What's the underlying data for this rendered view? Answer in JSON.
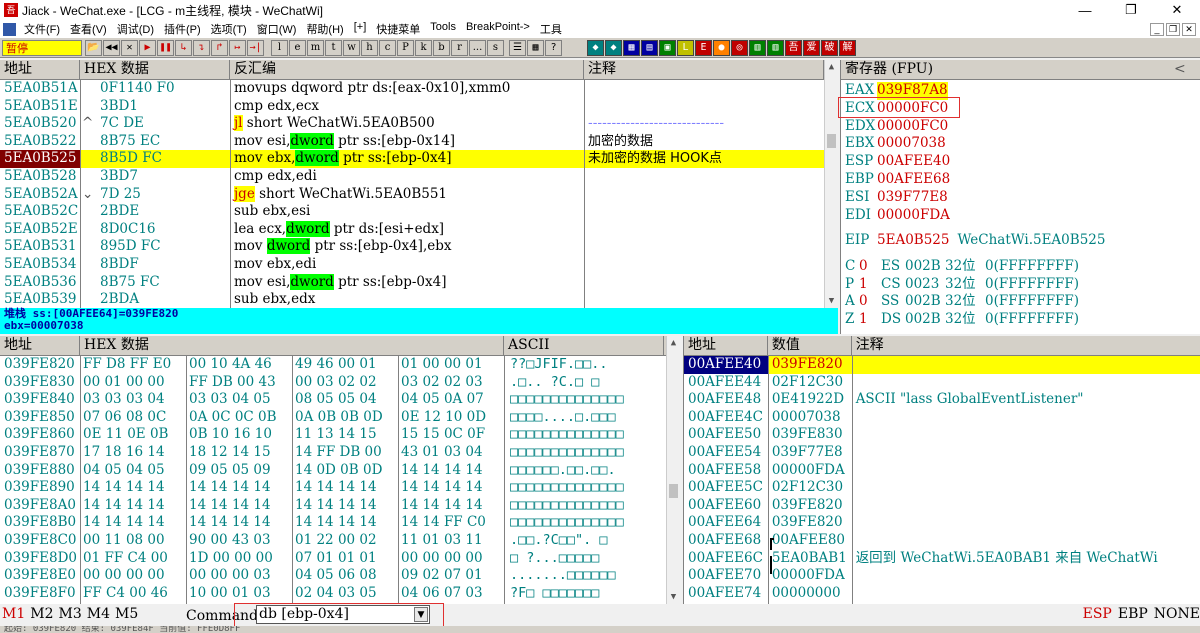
{
  "window": {
    "title": "Jiack  - WeChat.exe - [LCG - m主线程, 模块 - WeChatWi]",
    "min": "—",
    "max": "❐",
    "close": "✕"
  },
  "menu": [
    "文件(F)",
    "查看(V)",
    "调试(D)",
    "插件(P)",
    "选项(T)",
    "窗口(W)",
    "帮助(H)",
    "[+]",
    "快捷菜单",
    "Tools",
    "BreakPoint->",
    "工具"
  ],
  "toolbar": {
    "status": "暂停",
    "buttons": [
      "📂",
      "◀◀",
      "✕",
      "▶",
      "❚❚",
      "↳",
      "↴",
      "↱",
      "↦",
      "→|"
    ],
    "letters": [
      "l",
      "e",
      "m",
      "t",
      "w",
      "h",
      "c",
      "P",
      "k",
      "b",
      "r",
      "...",
      "s"
    ],
    "extra": [
      "☰",
      "▦",
      "?"
    ],
    "colored": [
      "◆",
      "◆",
      "▦",
      "▤",
      "▣",
      "L",
      "E",
      "●",
      "◎",
      "▥",
      "▥",
      "吾",
      "爱",
      "破",
      "解"
    ],
    "colors": [
      "#008080",
      "#008080",
      "#0000a0",
      "#0000a0",
      "#008000",
      "#c0c000",
      "#c00000",
      "#ff8000",
      "#c00000",
      "#008000",
      "#008000",
      "#c00000",
      "#c00000",
      "#c00000",
      "#c00000"
    ]
  },
  "disasm": {
    "headers": [
      "地址",
      "HEX 数据",
      "反汇编",
      "注释"
    ],
    "rows": [
      {
        "addr": "5EA0B51A",
        "mark": "",
        "hex": "0F1140 F0",
        "asm": [
          [
            "",
            "movups dqword ptr ds:[eax-0x10],xmm0"
          ]
        ],
        "comment": "",
        "hl": false
      },
      {
        "addr": "5EA0B51E",
        "mark": "",
        "hex": "3BD1",
        "asm": [
          [
            "",
            "cmp edx,ecx"
          ]
        ],
        "comment": "",
        "hl": false
      },
      {
        "addr": "5EA0B520",
        "mark": "^",
        "hex": "7C DE",
        "asm": [
          [
            "y",
            "jl"
          ],
          [
            "",
            " short WeChatWi.5EA0B500"
          ]
        ],
        "comment": "-----------------------------",
        "hl": false
      },
      {
        "addr": "5EA0B522",
        "mark": "",
        "hex": "8B75 EC",
        "asm": [
          [
            "",
            "mov esi,"
          ],
          [
            "g",
            "dword"
          ],
          [
            "",
            " ptr ss:[ebp-0x14]"
          ]
        ],
        "comment": "加密的数据",
        "hl": false
      },
      {
        "addr": "5EA0B525",
        "mark": "",
        "hex": "8B5D FC",
        "asm": [
          [
            "",
            "mov ebx,"
          ],
          [
            "g",
            "dword"
          ],
          [
            "",
            " ptr ss:[ebp-0x4]"
          ]
        ],
        "comment": "未加密的数据 HOOK点",
        "hl": true
      },
      {
        "addr": "5EA0B528",
        "mark": "",
        "hex": "3BD7",
        "asm": [
          [
            "",
            "cmp edx,edi"
          ]
        ],
        "comment": "",
        "hl": false
      },
      {
        "addr": "5EA0B52A",
        "mark": "⌄",
        "hex": "7D 25",
        "asm": [
          [
            "y",
            "jge"
          ],
          [
            "",
            " short WeChatWi.5EA0B551"
          ]
        ],
        "comment": "",
        "hl": false
      },
      {
        "addr": "5EA0B52C",
        "mark": "",
        "hex": "2BDE",
        "asm": [
          [
            "",
            "sub ebx,esi"
          ]
        ],
        "comment": "",
        "hl": false
      },
      {
        "addr": "5EA0B52E",
        "mark": "",
        "hex": "8D0C16",
        "asm": [
          [
            "",
            "lea ecx,"
          ],
          [
            "g",
            "dword"
          ],
          [
            "",
            " ptr ds:[esi+edx]"
          ]
        ],
        "comment": "",
        "hl": false
      },
      {
        "addr": "5EA0B531",
        "mark": "",
        "hex": "895D FC",
        "asm": [
          [
            "",
            "mov "
          ],
          [
            "g",
            "dword"
          ],
          [
            "",
            " ptr ss:[ebp-0x4],ebx"
          ]
        ],
        "comment": "",
        "hl": false
      },
      {
        "addr": "5EA0B534",
        "mark": "",
        "hex": "8BDF",
        "asm": [
          [
            "",
            "mov ebx,edi"
          ]
        ],
        "comment": "",
        "hl": false
      },
      {
        "addr": "5EA0B536",
        "mark": "",
        "hex": "8B75 FC",
        "asm": [
          [
            "",
            "mov esi,"
          ],
          [
            "g",
            "dword"
          ],
          [
            "",
            " ptr ss:[ebp-0x4]"
          ]
        ],
        "comment": "",
        "hl": false
      },
      {
        "addr": "5EA0B539",
        "mark": "",
        "hex": "2BDA",
        "asm": [
          [
            "",
            "sub ebx,edx"
          ]
        ],
        "comment": "",
        "hl": false
      }
    ]
  },
  "info": {
    "line1": "堆栈 ss:[00AFEE64]=039FE820",
    "line2": "ebx=00007038"
  },
  "registers": {
    "title": "寄存器 (FPU)",
    "collapse": "<",
    "regs": [
      {
        "name": "EAX",
        "value": "039F87A8",
        "extra": "",
        "state": "hl"
      },
      {
        "name": "ECX",
        "value": "00000FC0",
        "extra": "",
        "state": "red"
      },
      {
        "name": "EDX",
        "value": "00000FC0",
        "extra": "",
        "state": ""
      },
      {
        "name": "EBX",
        "value": "00007038",
        "extra": "",
        "state": "red"
      },
      {
        "name": "ESP",
        "value": "00AFEE40",
        "extra": "",
        "state": ""
      },
      {
        "name": "EBP",
        "value": "00AFEE68",
        "extra": "",
        "state": ""
      },
      {
        "name": "ESI",
        "value": "039F77E8",
        "extra": "",
        "state": "red"
      },
      {
        "name": "EDI",
        "value": "00000FDA",
        "extra": "",
        "state": ""
      }
    ],
    "eip": {
      "name": "EIP",
      "value": "5EA0B525",
      "extra": "WeChatWi.5EA0B525"
    },
    "flags": [
      {
        "f": "C",
        "v": "0",
        "seg": "ES",
        "sv": "002B",
        "bits": "32位",
        "lim": "0(FFFFFFFF)"
      },
      {
        "f": "P",
        "v": "1",
        "seg": "CS",
        "sv": "0023",
        "bits": "32位",
        "lim": "0(FFFFFFFF)"
      },
      {
        "f": "A",
        "v": "0",
        "seg": "SS",
        "sv": "002B",
        "bits": "32位",
        "lim": "0(FFFFFFFF)"
      },
      {
        "f": "Z",
        "v": "1",
        "seg": "DS",
        "sv": "002B",
        "bits": "32位",
        "lim": "0(FFFFFFFF)"
      }
    ]
  },
  "dump": {
    "headers": [
      "地址",
      "HEX 数据",
      "ASCII"
    ],
    "rows": [
      {
        "addr": "039FE820",
        "hex": [
          "FF D8 FF E0",
          "00 10 4A 46",
          "49 46 00 01",
          "01 00 00 01"
        ],
        "ascii": "  ??□JFIF.□□.."
      },
      {
        "addr": "039FE830",
        "hex": [
          "00 01 00 00",
          "FF DB 00 43",
          "00 03 02 02",
          "03 02 02 03"
        ],
        "ascii": ".□..  ?C.□  □"
      },
      {
        "addr": "039FE840",
        "hex": [
          "03 03 03 04",
          "03 03 04 05",
          "08 05 05 04",
          "04 05 0A 07"
        ],
        "ascii": "□□□□□□□□□□□□□□"
      },
      {
        "addr": "039FE850",
        "hex": [
          "07 06 08 0C",
          "0A 0C 0C 0B",
          "0A 0B 0B 0D",
          "0E 12 10 0D"
        ],
        "ascii": "□□□□....□.□□□"
      },
      {
        "addr": "039FE860",
        "hex": [
          "0E 11 0E 0B",
          "0B 10 16 10",
          "11 13 14 15",
          "15 15 0C 0F"
        ],
        "ascii": "□□□□□□□□□□□□□□"
      },
      {
        "addr": "039FE870",
        "hex": [
          "17 18 16 14",
          "18 12 14 15",
          "14 FF DB 00",
          "43 01 03 04"
        ],
        "ascii": "□□□□□□□□□□□□□□"
      },
      {
        "addr": "039FE880",
        "hex": [
          "04 05 04 05",
          "09 05 05 09",
          "14 0D 0B 0D",
          "14 14 14 14"
        ],
        "ascii": "□□□□□□.□□.□□."
      },
      {
        "addr": "039FE890",
        "hex": [
          "14 14 14 14",
          "14 14 14 14",
          "14 14 14 14",
          "14 14 14 14"
        ],
        "ascii": "□□□□□□□□□□□□□□"
      },
      {
        "addr": "039FE8A0",
        "hex": [
          "14 14 14 14",
          "14 14 14 14",
          "14 14 14 14",
          "14 14 14 14"
        ],
        "ascii": "□□□□□□□□□□□□□□"
      },
      {
        "addr": "039FE8B0",
        "hex": [
          "14 14 14 14",
          "14 14 14 14",
          "14 14 14 14",
          "14 14 FF C0"
        ],
        "ascii": "□□□□□□□□□□□□□□"
      },
      {
        "addr": "039FE8C0",
        "hex": [
          "00 11 08 00",
          "90 00 43 03",
          "01 22 00 02",
          "11 01 03 11"
        ],
        "ascii": ".□□.?C□□\". □"
      },
      {
        "addr": "039FE8D0",
        "hex": [
          "01 FF C4 00",
          "1D 00 00 00",
          "07 01 01 01",
          "00 00 00 00"
        ],
        "ascii": "□  ?...□□□□□"
      },
      {
        "addr": "039FE8E0",
        "hex": [
          "00 00 00 00",
          "00 00 00 03",
          "04 05 06 08",
          "09 02 07 01"
        ],
        "ascii": ".......□□□□□□"
      },
      {
        "addr": "039FE8F0",
        "hex": [
          "FF C4 00 46",
          "10 00 01 03",
          "02 04 03 05",
          "04 06 07 03"
        ],
        "ascii": "  ?F□ □□□□□□□"
      }
    ]
  },
  "stack": {
    "headers": [
      "地址",
      "数值",
      "注释"
    ],
    "rows": [
      {
        "addr": "00AFEE40",
        "val": "039FE820",
        "comment": "",
        "sel": true,
        "brk": ""
      },
      {
        "addr": "00AFEE44",
        "val": "02F12C30",
        "comment": "",
        "sel": false,
        "brk": ""
      },
      {
        "addr": "00AFEE48",
        "val": "0E41922D",
        "comment": "ASCII \"lass GlobalEventListener\"",
        "sel": false,
        "brk": ""
      },
      {
        "addr": "00AFEE4C",
        "val": "00007038",
        "comment": "",
        "sel": false,
        "brk": ""
      },
      {
        "addr": "00AFEE50",
        "val": "039FE830",
        "comment": "",
        "sel": false,
        "brk": ""
      },
      {
        "addr": "00AFEE54",
        "val": "039F77E8",
        "comment": "",
        "sel": false,
        "brk": ""
      },
      {
        "addr": "00AFEE58",
        "val": "00000FDA",
        "comment": "",
        "sel": false,
        "brk": ""
      },
      {
        "addr": "00AFEE5C",
        "val": "02F12C30",
        "comment": "",
        "sel": false,
        "brk": ""
      },
      {
        "addr": "00AFEE60",
        "val": "039FE820",
        "comment": "",
        "sel": false,
        "brk": ""
      },
      {
        "addr": "00AFEE64",
        "val": "039FE820",
        "comment": "",
        "sel": false,
        "brk": ""
      },
      {
        "addr": "00AFEE68",
        "val": "00AFEE80",
        "comment": "",
        "sel": false,
        "brk": "top"
      },
      {
        "addr": "00AFEE6C",
        "val": "5EA0BAB1",
        "comment": "返回到 WeChatWi.5EA0BAB1 来自 WeChatWi",
        "sel": false,
        "brk": "mid"
      },
      {
        "addr": "00AFEE70",
        "val": "00000FDA",
        "comment": "",
        "sel": false,
        "brk": ""
      },
      {
        "addr": "00AFEE74",
        "val": "00000000",
        "comment": "",
        "sel": false,
        "brk": ""
      }
    ]
  },
  "cmd": {
    "mtabs": [
      "M1",
      "M2",
      "M3",
      "M4",
      "M5"
    ],
    "label": "Command:",
    "value": "db [ebp-0x4]",
    "right": [
      "ESP",
      "EBP",
      "NONE"
    ]
  },
  "status": "起始: 039FE820 结束: 039FE84F 当前值: FFE0D8FF"
}
